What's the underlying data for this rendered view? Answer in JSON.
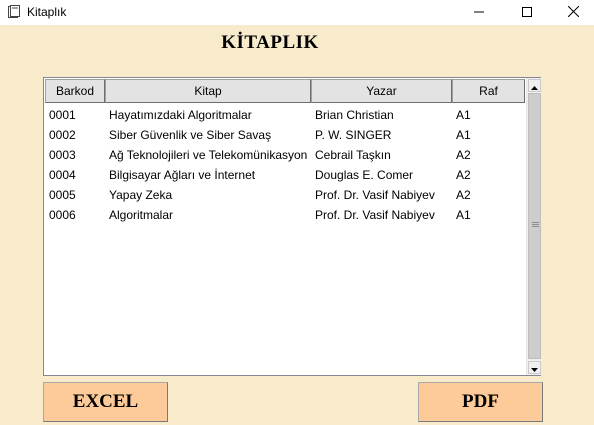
{
  "window": {
    "title": "Kitaplık"
  },
  "main": {
    "heading": "KİTAPLIK"
  },
  "table": {
    "columns": [
      "Barkod",
      "Kitap",
      "Yazar",
      "Raf"
    ],
    "rows": [
      [
        "0001",
        "Hayatımızdaki Algoritmalar",
        "Brian Christian",
        "A1"
      ],
      [
        "0002",
        "Siber Güvenlik ve Siber Savaş",
        "P. W. SINGER",
        "A1"
      ],
      [
        "0003",
        "Ağ Teknolojileri ve Telekomünikasyon",
        "Cebrail Taşkın",
        "A2"
      ],
      [
        "0004",
        "Bilgisayar Ağları ve İnternet",
        "Douglas E. Comer",
        "A2"
      ],
      [
        "0005",
        "Yapay Zeka",
        "Prof. Dr. Vasif Nabiyev",
        "A2"
      ],
      [
        "0006",
        "Algoritmalar",
        "Prof. Dr. Vasif Nabiyev",
        "A1"
      ]
    ]
  },
  "buttons": {
    "excel": "EXCEL",
    "pdf": "PDF"
  },
  "icons": {
    "app": "book-icon",
    "minimize": "minimize-icon",
    "maximize": "maximize-icon",
    "close": "close-icon",
    "scroll_up": "arrow-up-icon",
    "scroll_down": "arrow-down-icon"
  },
  "colors": {
    "background": "#f7ebcb",
    "button": "#fdcb99",
    "header": "#e3e3e3"
  }
}
